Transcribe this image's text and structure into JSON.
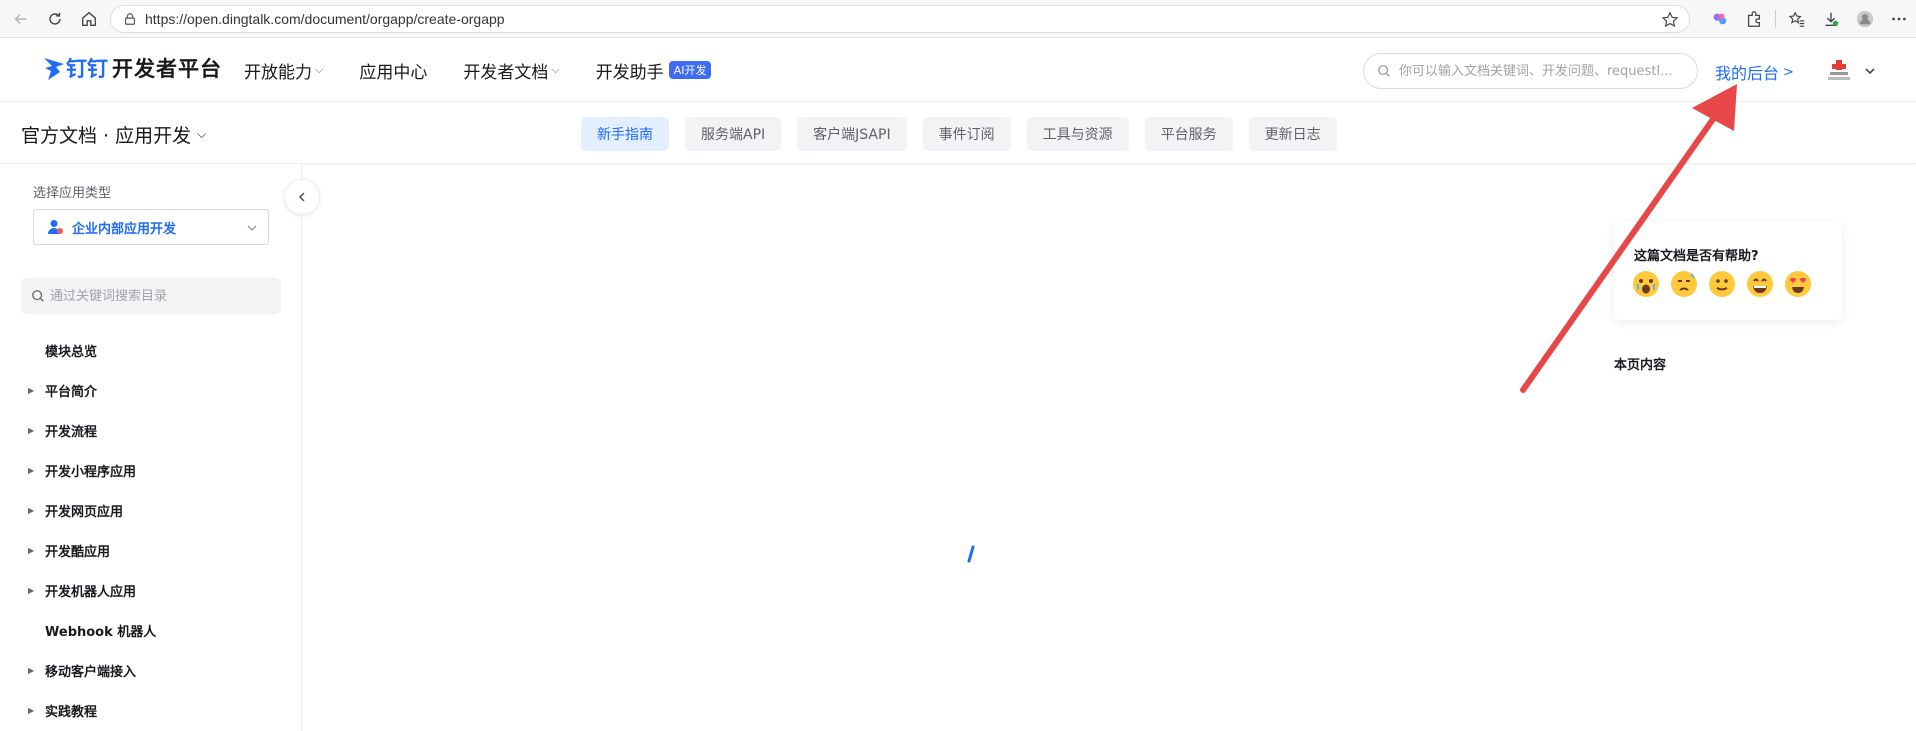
{
  "browser": {
    "url": "https://open.dingtalk.com/document/orgapp/create-orgapp"
  },
  "header": {
    "logo_ding": "钉钉",
    "logo_text": "开发者平台",
    "nav": [
      {
        "label": "开放能力",
        "has_dropdown": true
      },
      {
        "label": "应用中心",
        "has_dropdown": false
      },
      {
        "label": "开发者文档",
        "has_dropdown": true
      },
      {
        "label": "开发助手",
        "badge": "AI开发"
      }
    ],
    "search_placeholder": "你可以输入文档关键词、开发问题、requestI...",
    "my_backend": "我的后台",
    "my_backend_arrow": ">"
  },
  "subheader": {
    "breadcrumb": "官方文档 · 应用开发",
    "tabs": [
      {
        "label": "新手指南",
        "active": true
      },
      {
        "label": "服务端API",
        "active": false
      },
      {
        "label": "客户端JSAPI",
        "active": false
      },
      {
        "label": "事件订阅",
        "active": false
      },
      {
        "label": "工具与资源",
        "active": false
      },
      {
        "label": "平台服务",
        "active": false
      },
      {
        "label": "更新日志",
        "active": false
      }
    ]
  },
  "sidebar": {
    "select_label": "选择应用类型",
    "selected_app_type": "企业内部应用开发",
    "search_placeholder": "通过关键词搜索目录",
    "toc": [
      {
        "label": "模块总览",
        "expandable": false
      },
      {
        "label": "平台简介",
        "expandable": true
      },
      {
        "label": "开发流程",
        "expandable": true
      },
      {
        "label": "开发小程序应用",
        "expandable": true
      },
      {
        "label": "开发网页应用",
        "expandable": true
      },
      {
        "label": "开发酷应用",
        "expandable": true
      },
      {
        "label": "开发机器人应用",
        "expandable": true
      },
      {
        "label": "Webhook 机器人",
        "expandable": false
      },
      {
        "label": "移动客户端接入",
        "expandable": true
      },
      {
        "label": "实践教程",
        "expandable": true
      }
    ]
  },
  "feedback": {
    "question": "这篇文档是否有帮助?",
    "emojis": [
      "crying-face-icon",
      "sad-face-icon",
      "neutral-face-icon",
      "grinning-face-icon",
      "heart-eyes-face-icon"
    ]
  },
  "page_contents_label": "本页内容",
  "colors": {
    "brand_blue": "#1f6cf7",
    "annotation_red": "#e84747",
    "active_tab_bg": "#e3eeff"
  }
}
